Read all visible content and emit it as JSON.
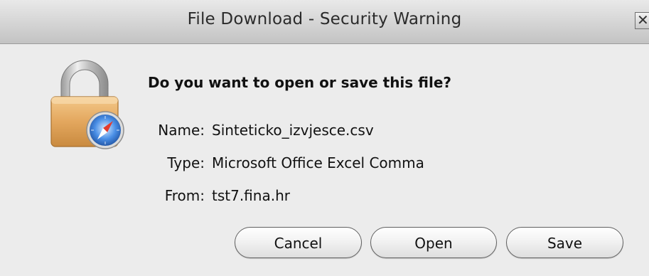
{
  "window": {
    "title": "File Download - Security Warning"
  },
  "dialog": {
    "question": "Do you want to open or save this file?",
    "fields": {
      "name_label": "Name:",
      "name_value": "Sinteticko_izvjesce.csv",
      "type_label": "Type:",
      "type_value": "Microsoft Office Excel Comma",
      "from_label": "From:",
      "from_value": "tst7.fina.hr"
    },
    "buttons": {
      "cancel": "Cancel",
      "open": "Open",
      "save": "Save"
    }
  },
  "icons": {
    "lock": "padlock-icon",
    "badge": "safari-compass-icon",
    "close": "close-icon"
  },
  "colors": {
    "dialog_bg": "#ececec",
    "lock_body": "#e8b06a",
    "compass_blue": "#2a6fd4"
  }
}
